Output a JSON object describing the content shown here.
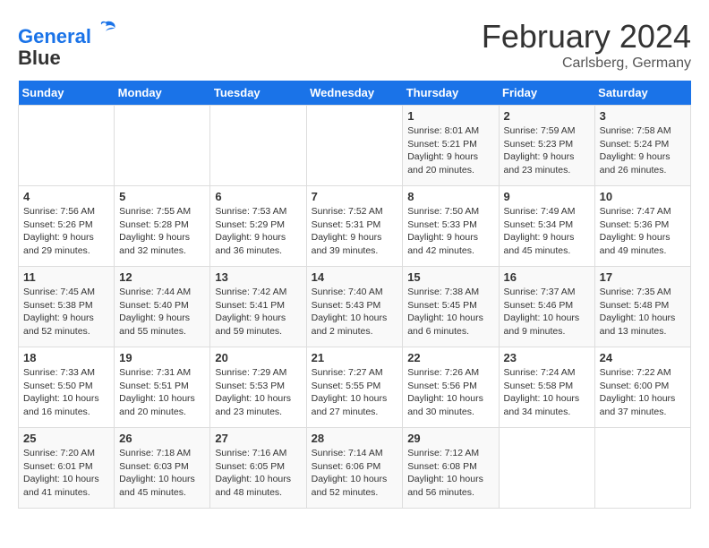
{
  "header": {
    "logo_line1": "General",
    "logo_line2": "Blue",
    "month_title": "February 2024",
    "location": "Carlsberg, Germany"
  },
  "weekdays": [
    "Sunday",
    "Monday",
    "Tuesday",
    "Wednesday",
    "Thursday",
    "Friday",
    "Saturday"
  ],
  "weeks": [
    [
      {
        "day": "",
        "info": ""
      },
      {
        "day": "",
        "info": ""
      },
      {
        "day": "",
        "info": ""
      },
      {
        "day": "",
        "info": ""
      },
      {
        "day": "1",
        "info": "Sunrise: 8:01 AM\nSunset: 5:21 PM\nDaylight: 9 hours\nand 20 minutes."
      },
      {
        "day": "2",
        "info": "Sunrise: 7:59 AM\nSunset: 5:23 PM\nDaylight: 9 hours\nand 23 minutes."
      },
      {
        "day": "3",
        "info": "Sunrise: 7:58 AM\nSunset: 5:24 PM\nDaylight: 9 hours\nand 26 minutes."
      }
    ],
    [
      {
        "day": "4",
        "info": "Sunrise: 7:56 AM\nSunset: 5:26 PM\nDaylight: 9 hours\nand 29 minutes."
      },
      {
        "day": "5",
        "info": "Sunrise: 7:55 AM\nSunset: 5:28 PM\nDaylight: 9 hours\nand 32 minutes."
      },
      {
        "day": "6",
        "info": "Sunrise: 7:53 AM\nSunset: 5:29 PM\nDaylight: 9 hours\nand 36 minutes."
      },
      {
        "day": "7",
        "info": "Sunrise: 7:52 AM\nSunset: 5:31 PM\nDaylight: 9 hours\nand 39 minutes."
      },
      {
        "day": "8",
        "info": "Sunrise: 7:50 AM\nSunset: 5:33 PM\nDaylight: 9 hours\nand 42 minutes."
      },
      {
        "day": "9",
        "info": "Sunrise: 7:49 AM\nSunset: 5:34 PM\nDaylight: 9 hours\nand 45 minutes."
      },
      {
        "day": "10",
        "info": "Sunrise: 7:47 AM\nSunset: 5:36 PM\nDaylight: 9 hours\nand 49 minutes."
      }
    ],
    [
      {
        "day": "11",
        "info": "Sunrise: 7:45 AM\nSunset: 5:38 PM\nDaylight: 9 hours\nand 52 minutes."
      },
      {
        "day": "12",
        "info": "Sunrise: 7:44 AM\nSunset: 5:40 PM\nDaylight: 9 hours\nand 55 minutes."
      },
      {
        "day": "13",
        "info": "Sunrise: 7:42 AM\nSunset: 5:41 PM\nDaylight: 9 hours\nand 59 minutes."
      },
      {
        "day": "14",
        "info": "Sunrise: 7:40 AM\nSunset: 5:43 PM\nDaylight: 10 hours\nand 2 minutes."
      },
      {
        "day": "15",
        "info": "Sunrise: 7:38 AM\nSunset: 5:45 PM\nDaylight: 10 hours\nand 6 minutes."
      },
      {
        "day": "16",
        "info": "Sunrise: 7:37 AM\nSunset: 5:46 PM\nDaylight: 10 hours\nand 9 minutes."
      },
      {
        "day": "17",
        "info": "Sunrise: 7:35 AM\nSunset: 5:48 PM\nDaylight: 10 hours\nand 13 minutes."
      }
    ],
    [
      {
        "day": "18",
        "info": "Sunrise: 7:33 AM\nSunset: 5:50 PM\nDaylight: 10 hours\nand 16 minutes."
      },
      {
        "day": "19",
        "info": "Sunrise: 7:31 AM\nSunset: 5:51 PM\nDaylight: 10 hours\nand 20 minutes."
      },
      {
        "day": "20",
        "info": "Sunrise: 7:29 AM\nSunset: 5:53 PM\nDaylight: 10 hours\nand 23 minutes."
      },
      {
        "day": "21",
        "info": "Sunrise: 7:27 AM\nSunset: 5:55 PM\nDaylight: 10 hours\nand 27 minutes."
      },
      {
        "day": "22",
        "info": "Sunrise: 7:26 AM\nSunset: 5:56 PM\nDaylight: 10 hours\nand 30 minutes."
      },
      {
        "day": "23",
        "info": "Sunrise: 7:24 AM\nSunset: 5:58 PM\nDaylight: 10 hours\nand 34 minutes."
      },
      {
        "day": "24",
        "info": "Sunrise: 7:22 AM\nSunset: 6:00 PM\nDaylight: 10 hours\nand 37 minutes."
      }
    ],
    [
      {
        "day": "25",
        "info": "Sunrise: 7:20 AM\nSunset: 6:01 PM\nDaylight: 10 hours\nand 41 minutes."
      },
      {
        "day": "26",
        "info": "Sunrise: 7:18 AM\nSunset: 6:03 PM\nDaylight: 10 hours\nand 45 minutes."
      },
      {
        "day": "27",
        "info": "Sunrise: 7:16 AM\nSunset: 6:05 PM\nDaylight: 10 hours\nand 48 minutes."
      },
      {
        "day": "28",
        "info": "Sunrise: 7:14 AM\nSunset: 6:06 PM\nDaylight: 10 hours\nand 52 minutes."
      },
      {
        "day": "29",
        "info": "Sunrise: 7:12 AM\nSunset: 6:08 PM\nDaylight: 10 hours\nand 56 minutes."
      },
      {
        "day": "",
        "info": ""
      },
      {
        "day": "",
        "info": ""
      }
    ]
  ]
}
